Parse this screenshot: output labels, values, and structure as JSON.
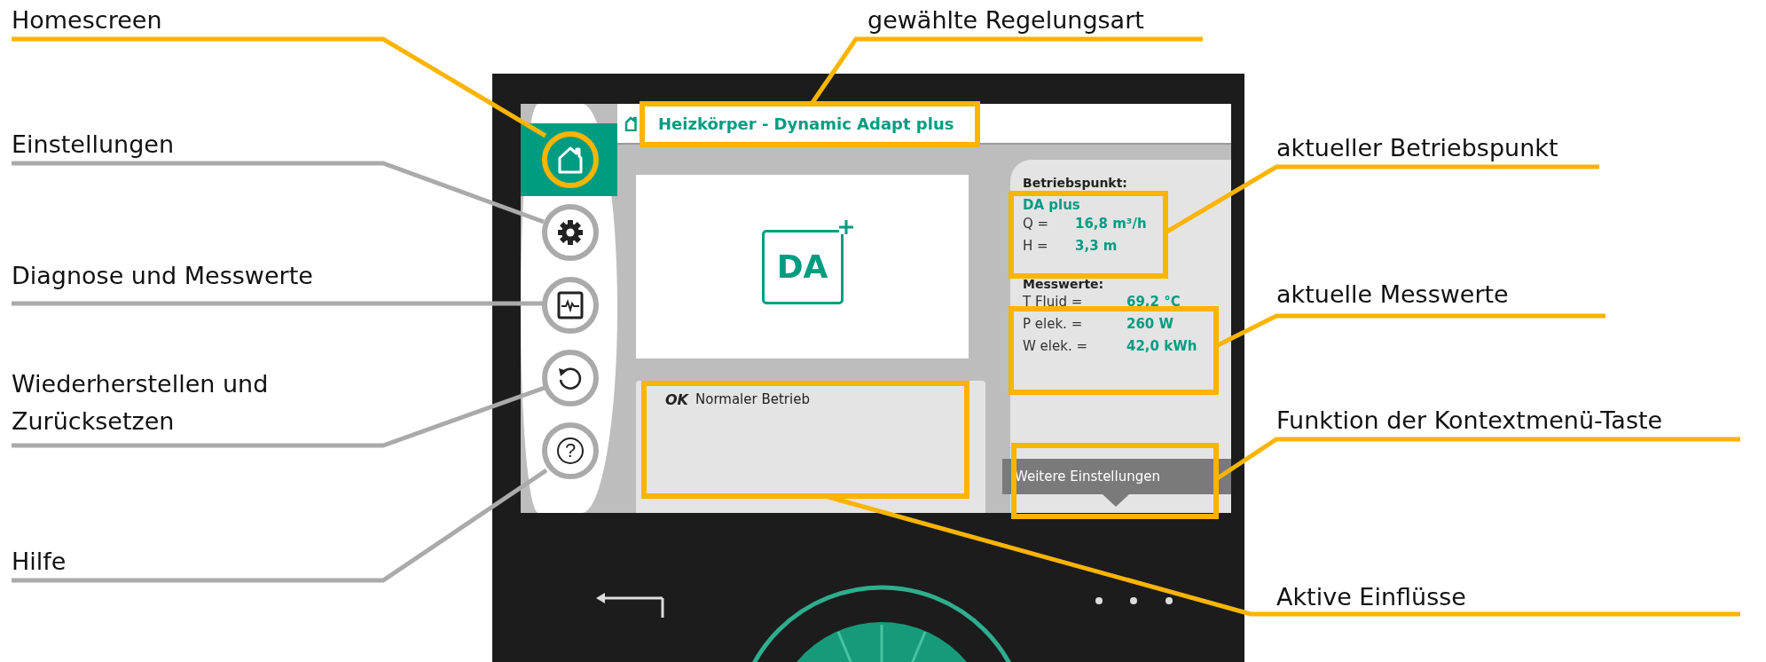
{
  "annotations": [
    {
      "label": "Homescreen",
      "highlighted": true
    },
    {
      "label": "Einstellungen",
      "highlighted": false
    },
    {
      "label": "Diagnose und Messwerte",
      "highlighted": false
    },
    {
      "label": "Wiederherstellen und Zurücksetzen",
      "highlighted": false
    },
    {
      "label": "Hilfe",
      "highlighted": false
    },
    {
      "label": "gewählte Regelungsart",
      "highlighted": true
    },
    {
      "label": "aktueller Betriebspunkt",
      "highlighted": true
    },
    {
      "label": "aktuelle Messwerte",
      "highlighted": true
    },
    {
      "label": "Funktion der Kontextmenü-Taste",
      "highlighted": true
    },
    {
      "label": "Aktive Einflüsse",
      "highlighted": true
    }
  ],
  "screen": {
    "title": "Heizkörper - Dynamic Adapt plus",
    "menu": [
      {
        "kind": "home",
        "selected": true
      },
      {
        "kind": "settings",
        "selected": false
      },
      {
        "kind": "diagnostics",
        "selected": false
      },
      {
        "kind": "restore",
        "selected": false
      },
      {
        "kind": "help",
        "selected": false,
        "symbol": "?"
      }
    ],
    "mode_badge": "DA",
    "status": {
      "code": "OK",
      "text": "Normaler Betrieb"
    },
    "operating_point": {
      "heading": "Betriebspunkt:",
      "mode": "DA plus",
      "rows": [
        {
          "label": "Q =",
          "value": "16,8 m³/h"
        },
        {
          "label": "H =",
          "value": "3,3 m"
        }
      ]
    },
    "measurements": {
      "heading": "Messwerte:",
      "rows": [
        {
          "label": "T Fluid =",
          "value": "69,2 °C"
        },
        {
          "label": "P elek. =",
          "value": "260 W"
        },
        {
          "label": "W elek. =",
          "value": "42,0 kWh"
        }
      ]
    },
    "context_button": "Weitere Einstellungen"
  }
}
